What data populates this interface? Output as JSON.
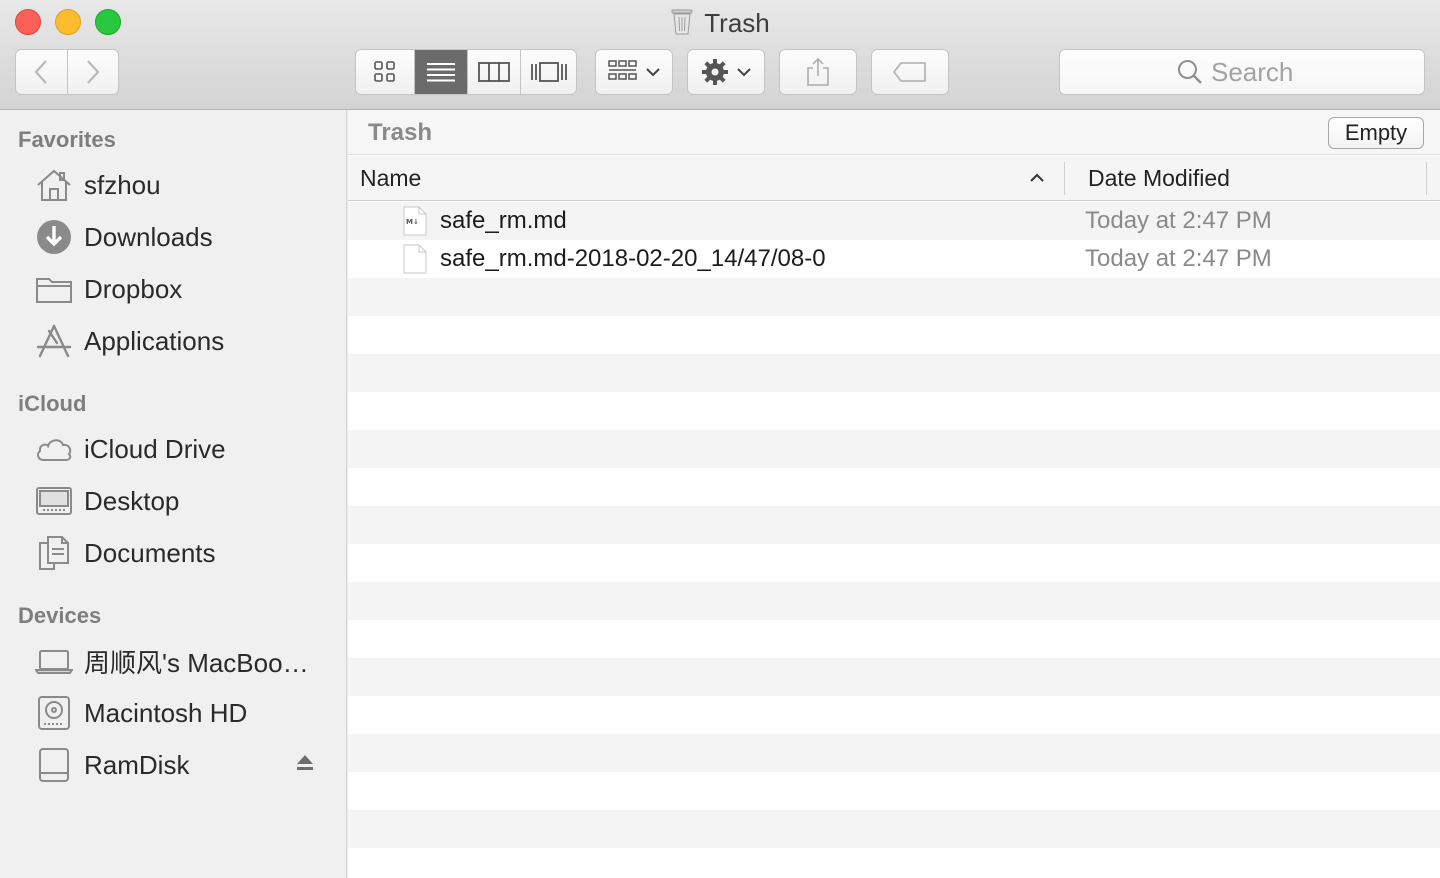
{
  "window": {
    "title": "Trash"
  },
  "toolbar": {
    "back_icon": "chevron-left-icon",
    "forward_icon": "chevron-right-icon",
    "view_modes": [
      "icon-view",
      "list-view",
      "column-view",
      "cover-flow-view"
    ],
    "active_view": "list-view",
    "search_placeholder": "Search"
  },
  "sidebar": {
    "favorites": {
      "title": "Favorites",
      "items": [
        {
          "label": "sfzhou",
          "icon": "home-icon"
        },
        {
          "label": "Downloads",
          "icon": "downloads-icon"
        },
        {
          "label": "Dropbox",
          "icon": "folder-icon"
        },
        {
          "label": "Applications",
          "icon": "applications-icon"
        }
      ]
    },
    "icloud": {
      "title": "iCloud",
      "items": [
        {
          "label": "iCloud Drive",
          "icon": "cloud-icon"
        },
        {
          "label": "Desktop",
          "icon": "desktop-icon"
        },
        {
          "label": "Documents",
          "icon": "documents-icon"
        }
      ]
    },
    "devices": {
      "title": "Devices",
      "items": [
        {
          "label": "周顺风's MacBoo…",
          "icon": "laptop-icon"
        },
        {
          "label": "Macintosh HD",
          "icon": "harddisk-icon"
        },
        {
          "label": "RamDisk",
          "icon": "disk-icon"
        }
      ]
    }
  },
  "main": {
    "folder_name": "Trash",
    "empty_button": "Empty",
    "columns": {
      "name": "Name",
      "date_modified": "Date Modified"
    },
    "files": [
      {
        "name": "safe_rm.md",
        "date": "Today at 2:47 PM",
        "icon": "markdown-file-icon"
      },
      {
        "name": "safe_rm.md-2018-02-20_14/47/08-0",
        "date": "Today at 2:47 PM",
        "icon": "blank-file-icon"
      }
    ]
  },
  "colors": {
    "close": "#fc5f57",
    "minimize": "#fdbc2e",
    "zoom": "#28c840",
    "sidebar_bg": "#f0f0f0",
    "row_stripe": "#f4f4f4"
  }
}
